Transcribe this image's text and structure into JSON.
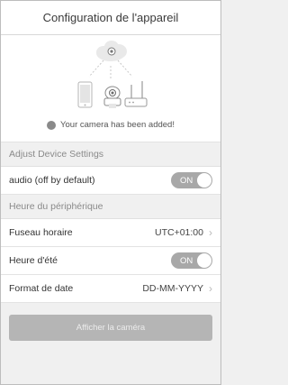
{
  "header": {
    "title": "Configuration de l'appareil"
  },
  "hero": {
    "status_text": "Your camera has been added!"
  },
  "sections": {
    "adjust": "Adjust Device Settings",
    "time": "Heure du périphérique"
  },
  "audio": {
    "label": "audio (off by default)",
    "toggle": "ON"
  },
  "timezone": {
    "label": "Fuseau horaire",
    "value": "UTC+01:00"
  },
  "dst": {
    "label": "Heure d'été",
    "toggle": "ON"
  },
  "date_format": {
    "label": "Format de date",
    "value": "DD-MM-YYYY"
  },
  "actions": {
    "show_camera": "Afficher la caméra"
  }
}
